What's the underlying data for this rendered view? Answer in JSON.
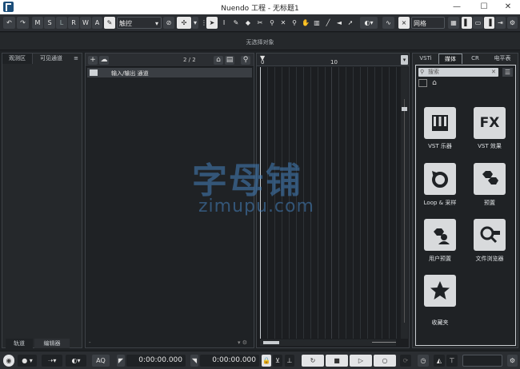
{
  "window": {
    "title": "Nuendo 工程 - 无标题1",
    "minimize": "—",
    "maximize": "☐",
    "close": "✕"
  },
  "toolbar": {
    "modes": [
      "M",
      "S",
      "L",
      "R",
      "W",
      "A"
    ],
    "automation_mode": "触控",
    "grid_type": "网格",
    "grid_prefix": "×"
  },
  "infoline": {
    "text": "无选择对象"
  },
  "left_zone": {
    "tabs": [
      "观测区",
      "可见通道"
    ],
    "menu_icon": "≡",
    "bottom_tabs": [
      "轨道",
      "编辑器"
    ]
  },
  "track_list": {
    "add_icon": "+",
    "counter": "2 / 2",
    "tracks": [
      {
        "name": "输入/输出 通道"
      }
    ]
  },
  "ruler": {
    "marks": [
      "0",
      "10"
    ]
  },
  "right_zone": {
    "tabs": [
      "VSTi",
      "媒体",
      "CR",
      "电平表"
    ],
    "active_tab": "媒体",
    "search_placeholder": "搜索",
    "home_icon": "⌂",
    "items": [
      {
        "label": "VST 乐器",
        "icon": "piano-icon"
      },
      {
        "label": "VST 效果",
        "icon": "fx-icon",
        "glyph": "FX"
      },
      {
        "label": "Loop & 采样",
        "icon": "loop-icon"
      },
      {
        "label": "预置",
        "icon": "hexagons-icon"
      },
      {
        "label": "用户预置",
        "icon": "user-preset-icon"
      },
      {
        "label": "文件浏览器",
        "icon": "file-browser-icon"
      },
      {
        "label": "收藏夹",
        "icon": "star-icon"
      }
    ]
  },
  "transport": {
    "aq_label": "AQ",
    "left_locator": "0:00:00.000",
    "right_locator": "0:00:00.000"
  },
  "watermark": {
    "main": "字母铺",
    "sub": "zimupu.com"
  }
}
